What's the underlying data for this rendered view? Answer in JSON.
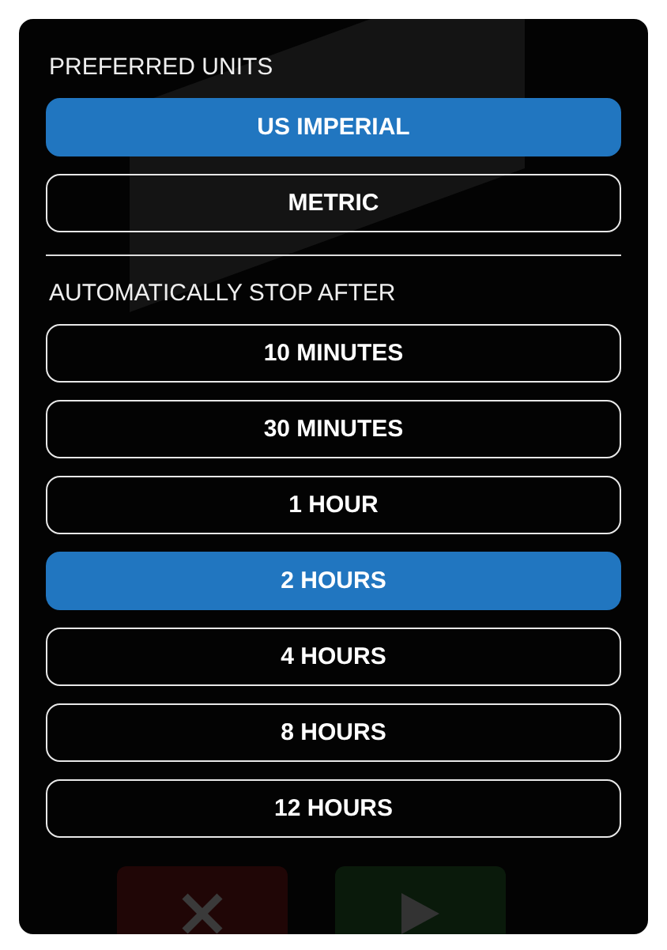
{
  "preferred_units": {
    "heading": "PREFERRED UNITS",
    "options": [
      {
        "label": "US IMPERIAL",
        "selected": true
      },
      {
        "label": "METRIC",
        "selected": false
      }
    ]
  },
  "auto_stop": {
    "heading": "AUTOMATICALLY STOP AFTER",
    "options": [
      {
        "label": "10 MINUTES",
        "selected": false
      },
      {
        "label": "30 MINUTES",
        "selected": false
      },
      {
        "label": "1 HOUR",
        "selected": false
      },
      {
        "label": "2 HOURS",
        "selected": true
      },
      {
        "label": "4 HOURS",
        "selected": false
      },
      {
        "label": "8 HOURS",
        "selected": false
      },
      {
        "label": "12 HOURS",
        "selected": false
      }
    ]
  }
}
